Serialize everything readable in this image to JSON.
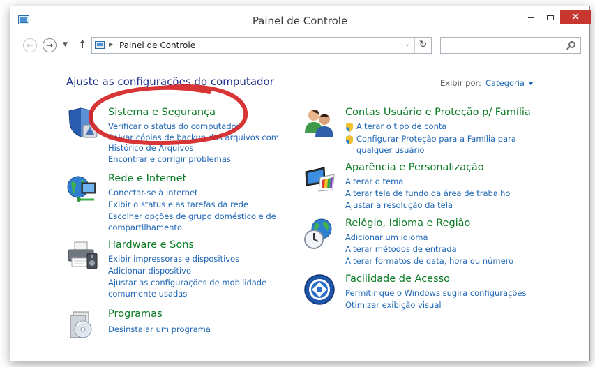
{
  "window": {
    "title": "Painel de Controle",
    "close_glyph": "✕",
    "controls": [
      "minimize-icon",
      "maximize-icon",
      "close-icon"
    ]
  },
  "nav": {
    "back_glyph": "←",
    "forward_glyph": "→",
    "recent_glyph": "▼",
    "up_glyph": "↑",
    "address_text": "Painel de Controle",
    "address_separator": "▶",
    "address_dropdown_glyph": "⌄",
    "refresh_glyph": "↻",
    "search_value": "",
    "search_placeholder": ""
  },
  "header": {
    "title": "Ajuste as configurações do computador",
    "view_label": "Exibir por:",
    "view_value": "Categoria"
  },
  "categories": [
    {
      "id": "sistema",
      "icon": "security-shield-icon",
      "title": "Sistema e Segurança",
      "links": [
        "Verificar o status do computador",
        "Salvar cópias de backup dos arquivos com",
        "Histórico de Arquivos",
        "Encontrar e corrigir problemas"
      ]
    },
    {
      "id": "rede",
      "icon": "network-globe-icon",
      "title": "Rede e Internet",
      "links": [
        "Conectar-se à Internet",
        "Exibir o status e as tarefas da rede",
        "Escolher opções de grupo doméstico e de",
        "compartilhamento"
      ]
    },
    {
      "id": "hardware",
      "icon": "printer-icon",
      "title": "Hardware e Sons",
      "links": [
        "Exibir impressoras e dispositivos",
        "Adicionar dispositivo",
        "Ajustar as configurações de mobilidade",
        "comumente usadas"
      ]
    },
    {
      "id": "programas",
      "icon": "programs-disc-icon",
      "title": "Programas",
      "links": [
        "Desinstalar um programa"
      ]
    },
    {
      "id": "contas",
      "icon": "users-icon",
      "title": "Contas Usuário e Proteção p/ Família",
      "links": [
        "Alterar o tipo de conta",
        "Configurar Proteção para a Família para",
        "qualquer usuário"
      ]
    },
    {
      "id": "aparencia",
      "icon": "display-palette-icon",
      "title": "Aparência e Personalização",
      "links": [
        "Alterar o tema",
        "Alterar tela de fundo da área de trabalho",
        "Ajustar a resolução da tela"
      ]
    },
    {
      "id": "relogio",
      "icon": "clock-globe-icon",
      "title": "Relógio, Idioma e Região",
      "links": [
        "Adicionar um idioma",
        "Alterar métodos de entrada",
        "Alterar formatos de data, hora ou número"
      ]
    },
    {
      "id": "facilidade",
      "icon": "ease-of-access-icon",
      "title": "Facilidade de Acesso",
      "links": [
        "Permitir que o Windows sugira configurações",
        "Otimizar exibição visual"
      ]
    }
  ],
  "colors": {
    "category_title": "#0a7a24",
    "link": "#1e66b4",
    "page_title": "#1e3287",
    "close_button": "#c7372f",
    "annotation_circle": "#d42020"
  }
}
